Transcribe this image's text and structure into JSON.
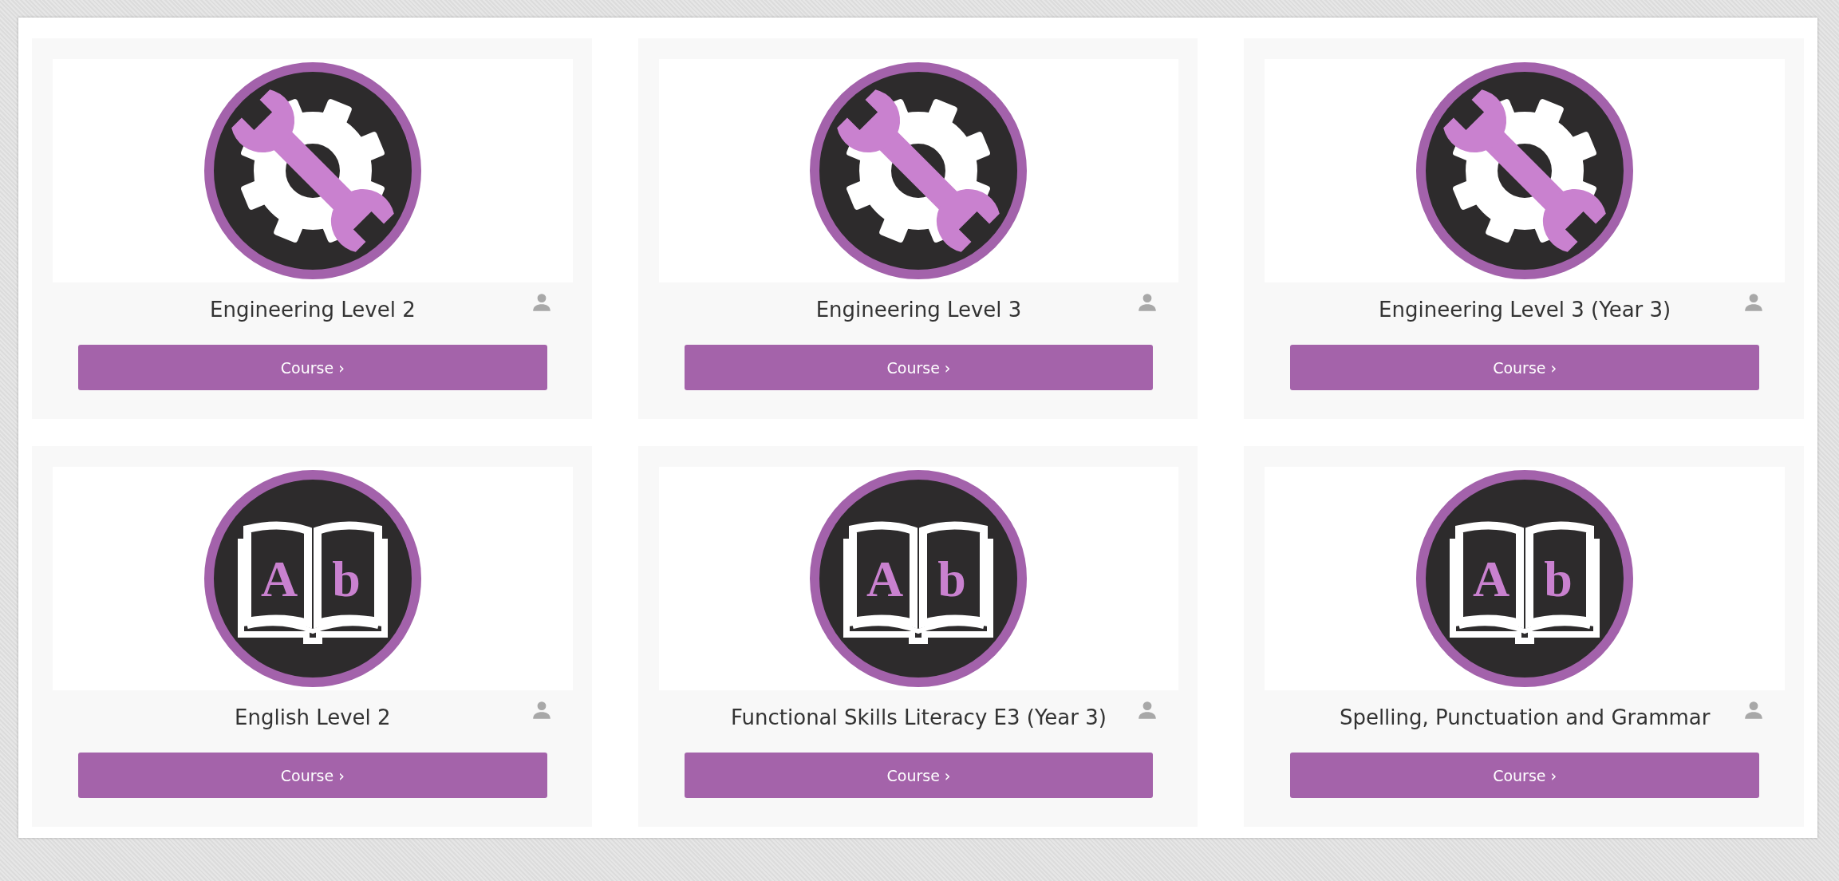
{
  "courses": [
    {
      "title": "Engineering Level 2",
      "kind": "gear",
      "button": "Course ›"
    },
    {
      "title": "Engineering Level 3",
      "kind": "gear",
      "button": "Course ›"
    },
    {
      "title": "Engineering Level 3 (Year 3)",
      "kind": "gear",
      "button": "Course ›"
    },
    {
      "title": "English Level 2",
      "kind": "book",
      "icon_letters": [
        "A",
        "b"
      ],
      "button": "Course ›"
    },
    {
      "title": "Functional Skills Literacy E3 (Year 3)",
      "kind": "book",
      "icon_letters": [
        "A",
        "b"
      ],
      "button": "Course ›"
    },
    {
      "title": "Spelling, Punctuation and Grammar",
      "kind": "book",
      "icon_letters": [
        "A",
        "b"
      ],
      "button": "Course ›"
    }
  ]
}
